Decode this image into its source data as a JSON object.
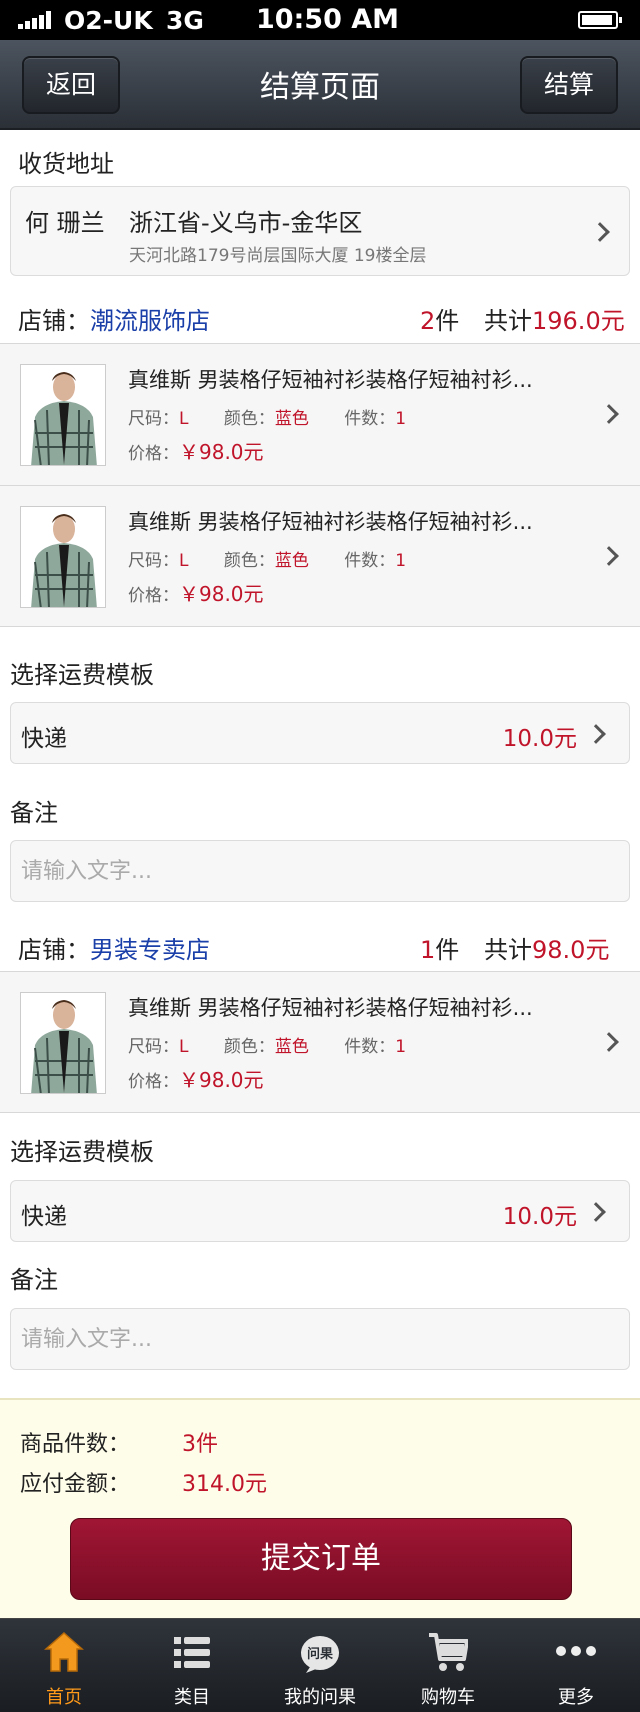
{
  "status_bar": {
    "carrier": "O2-UK",
    "network": "3G",
    "time": "10:50 AM"
  },
  "navbar": {
    "back_label": "返回",
    "title": "结算页面",
    "checkout_label": "结算"
  },
  "address": {
    "section_title": "收货地址",
    "name": "何 珊兰",
    "region": "浙江省-义乌市-金华区",
    "street": "天河北路179号尚层国际大厦 19楼全层"
  },
  "shops": [
    {
      "label": "店铺：",
      "name": "潮流服饰店",
      "count_num": "2",
      "count_unit": "件",
      "total_label": "共计",
      "total_value": "196.0元",
      "products": [
        {
          "name": "真维斯 男装格仔短袖衬衫装格仔短袖衬衫...",
          "size_label": "尺码：",
          "size": "L",
          "color_label": "颜色：",
          "color": "蓝色",
          "qty_label": "件数：",
          "qty": "1",
          "price_label": "价格：",
          "price": "￥98.0元"
        },
        {
          "name": "真维斯 男装格仔短袖衬衫装格仔短袖衬衫...",
          "size_label": "尺码：",
          "size": "L",
          "color_label": "颜色：",
          "color": "蓝色",
          "qty_label": "件数：",
          "qty": "1",
          "price_label": "价格：",
          "price": "￥98.0元"
        }
      ],
      "shipping_title": "选择运费模板",
      "shipping_method": "快递",
      "shipping_price": "10.0元",
      "remark_title": "备注",
      "remark_placeholder": "请输入文字..."
    },
    {
      "label": "店铺：",
      "name": "男装专卖店",
      "count_num": "1",
      "count_unit": "件",
      "total_label": "共计",
      "total_value": "98.0元",
      "products": [
        {
          "name": "真维斯 男装格仔短袖衬衫装格仔短袖衬衫...",
          "size_label": "尺码：",
          "size": "L",
          "color_label": "颜色：",
          "color": "蓝色",
          "qty_label": "件数：",
          "qty": "1",
          "price_label": "价格：",
          "price": "￥98.0元"
        }
      ],
      "shipping_title": "选择运费模板",
      "shipping_method": "快递",
      "shipping_price": "10.0元",
      "remark_title": "备注",
      "remark_placeholder": "请输入文字..."
    }
  ],
  "summary": {
    "items_label": "商品件数：",
    "items_value": "3件",
    "amount_label": "应付金额：",
    "amount_value": "314.0元",
    "submit_label": "提交订单"
  },
  "tabbar": [
    {
      "label": "首页",
      "icon": "home-icon",
      "active": true
    },
    {
      "label": "类目",
      "icon": "list-icon",
      "active": false
    },
    {
      "label": "我的问果",
      "icon": "wenguo-logo-icon",
      "logo_text": "问果",
      "active": false
    },
    {
      "label": "购物车",
      "icon": "cart-icon",
      "active": false
    },
    {
      "label": "更多",
      "icon": "more-icon",
      "active": false
    }
  ],
  "colors": {
    "accent_red": "#c0142a",
    "shop_blue": "#1a3fa8",
    "tab_active": "#ff9a1a",
    "submit_bg": "#8e1030"
  }
}
